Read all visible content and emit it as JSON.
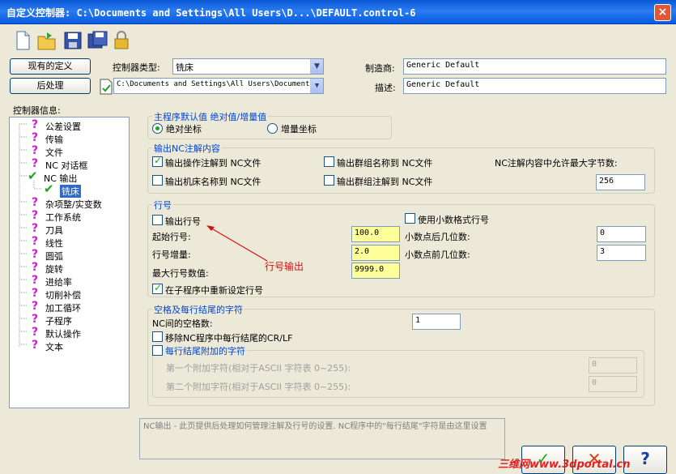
{
  "window": {
    "title": "自定义控制器: C:\\Documents and Settings\\All Users\\D...\\DEFAULT.control-6",
    "close": "×"
  },
  "toolbar": [
    "new-file-icon",
    "open-folder-icon",
    "save-icon",
    "save-as-icon",
    "lock-icon"
  ],
  "buttons": {
    "current_def": "现有的定义",
    "post": "后处理"
  },
  "controller_type": {
    "label": "控制器类型:",
    "value": "铣床"
  },
  "post_path": "C:\\Documents and Settings\\All Users\\Documents",
  "manufacturer": {
    "label": "制造商:",
    "value": "Generic Default"
  },
  "description": {
    "label": "描述:",
    "value": "Generic Default"
  },
  "tree": {
    "label": "控制器信息:",
    "items": [
      "公差设置",
      "传输",
      "文件",
      "NC 对话框",
      "NC 输出",
      "铣床",
      "杂项整/实变数",
      "工作系统",
      "刀具",
      "线性",
      "圆弧",
      "旋转",
      "进给率",
      "切削补偿",
      "加工循环",
      "子程序",
      "默认操作",
      "文本"
    ]
  },
  "main_default": {
    "title": "主程序默认值 绝对值/增量值",
    "absolute": "绝对坐标",
    "incremental": "增量坐标"
  },
  "nc_comment": {
    "title": "输出NC注解内容",
    "opt1": "输出操作注解到 NC文件",
    "opt2": "输出群组名称到 NC文件",
    "opt3": "输出机床名称到 NC文件",
    "opt4": "输出群组注解到 NC文件",
    "maxbytes_label": "NC注解内容中允许最大字节数:",
    "maxbytes": "256"
  },
  "line_num": {
    "title": "行号",
    "output": "输出行号",
    "use_decimal": "使用小数格式行号",
    "start_label": "起始行号:",
    "start": "100.0",
    "inc_label": "行号增量:",
    "inc": "2.0",
    "max_label": "最大行号数值:",
    "max": "9999.0",
    "after_label": "小数点后几位数:",
    "after": "0",
    "before_label": "小数点前几位数:",
    "before": "3",
    "reset": "在子程序中重新设定行号",
    "annotation": "行号输出"
  },
  "spaces": {
    "title": "空格及每行结尾的字符",
    "count_label": "NC间的空格数:",
    "count": "1",
    "remove": "移除NC程序中每行结尾的CR/LF",
    "append": "每行结尾附加的字符",
    "first_label": "第一个附加字符(相对于ASCII 字符表 0~255):",
    "first": "0",
    "second_label": "第二个附加字符(相对于ASCII 字符表 0~255):",
    "second": "0"
  },
  "info": "NC输出 - 此页提供后处理如何管理注解及行号的设置. NC程序中的\"每行结尾\"字符是由这里设置",
  "dialog_buttons": {
    "ok": "✓",
    "cancel": "✕",
    "help": "?"
  },
  "watermark": "三维网www.3dportal.cn"
}
